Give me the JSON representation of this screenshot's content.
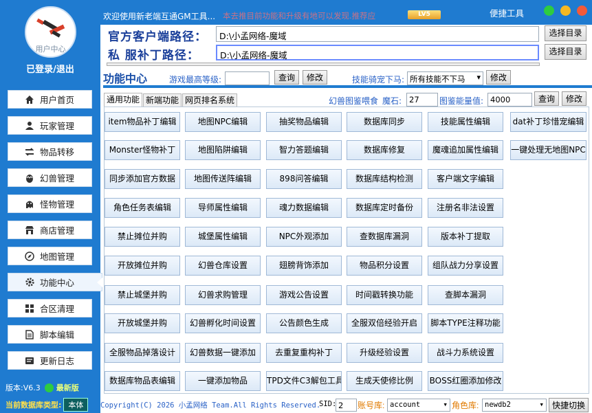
{
  "sidebar": {
    "logo_text": "用户中心",
    "login_text": "已登录/退出",
    "items": [
      {
        "label": "用户首页",
        "icon": "home-icon"
      },
      {
        "label": "玩家管理",
        "icon": "user-icon"
      },
      {
        "label": "物品转移",
        "icon": "transfer-icon"
      },
      {
        "label": "幻兽管理",
        "icon": "egg-icon"
      },
      {
        "label": "怪物管理",
        "icon": "monster-icon"
      },
      {
        "label": "商店管理",
        "icon": "shop-icon"
      },
      {
        "label": "地图管理",
        "icon": "map-icon"
      },
      {
        "label": "功能中心",
        "icon": "gear-icon"
      },
      {
        "label": "合区清理",
        "icon": "merge-icon"
      },
      {
        "label": "脚本编辑",
        "icon": "document-icon"
      },
      {
        "label": "更新日志",
        "icon": "log-icon"
      }
    ],
    "version_label": "版本:V6.3",
    "latest_label": "最新版",
    "db_type_label": "当前数据库类型:",
    "db_type_value": "本体"
  },
  "topbar": {
    "welcome": "欢迎使用新老端互通GM工具...",
    "notice": "本去推目前功能和升级有地可以发现.推荐应",
    "level_badge": "LV5",
    "quick_tools": "便捷工具"
  },
  "paths": {
    "client_label": "官方客户端路径：",
    "client_value": "D:\\小孟网络-魔域",
    "patch_label": "私  服补丁路径：",
    "patch_value": "D:\\小孟网络-魔域",
    "select_label": "选择目录"
  },
  "function_center": {
    "title": "功能中心",
    "max_level_label": "游戏最高等级:",
    "max_level_value": "",
    "query_label": "查询",
    "modify_label": "修改",
    "skill_label": "技能骑宠下马:",
    "skill_value": "所有技能不下马",
    "feed_label": "幻兽图鉴喂食",
    "magic_stone_label": "魔石:",
    "magic_stone_value": "27",
    "energy_label": "图鉴能量值:",
    "energy_value": "4000"
  },
  "tabs": [
    "通用功能",
    "新端功能",
    "网页排名系统"
  ],
  "buttons": [
    [
      "item物品补丁编辑",
      "地图NPC编辑",
      "抽奖物品编辑",
      "数据库同步",
      "技能属性编辑",
      "dat补丁珍惜宠编辑"
    ],
    [
      "Monster怪物补丁",
      "地图陷阱编辑",
      "智力答题编辑",
      "数据库修复",
      "魔魂追加属性编辑",
      "一键处理无地图NPC"
    ],
    [
      "同步添加官方数据",
      "地图传送阵编辑",
      "898问答编辑",
      "数据库结构检测",
      "客户端文字编辑"
    ],
    [
      "角色任务表编辑",
      "导师属性编辑",
      "魂力数据编辑",
      "数据库定时备份",
      "注册名非法设置"
    ],
    [
      "禁止摊位并购",
      "城堡属性编辑",
      "NPC外观添加",
      "查数据库漏洞",
      "版本补丁提取"
    ],
    [
      "开放摊位并购",
      "幻兽仓库设置",
      "翅膀背饰添加",
      "物品积分设置",
      "组队战力分享设置"
    ],
    [
      "禁止城堡并购",
      "幻兽求购管理",
      "游戏公告设置",
      "时间戳转换功能",
      "查脚本漏洞"
    ],
    [
      "开放城堡并购",
      "幻兽孵化时间设置",
      "公告颜色生成",
      "全服双倍经验开启",
      "脚本TYPE注释功能"
    ],
    [
      "全服物品掉落设计",
      "幻兽数据一键添加",
      "去重复重构补丁",
      "升级经验设置",
      "战斗力系统设置"
    ],
    [
      "数据库物品表编辑",
      "一键添加物品",
      "TPD文件C3解包工具",
      "生成天使修比例",
      "BOSS红圈添加修改"
    ]
  ],
  "footer": {
    "copyright": "Copyright(C) 2026 小孟网络 Team.All Rights Reserved.",
    "sid_label": "SID:",
    "sid_value": "2",
    "account_db_label": "账号库:",
    "account_db_value": "account",
    "role_db_label": "角色库:",
    "role_db_value": "newdb2",
    "switch_label": "快捷切换"
  },
  "colors": {
    "sidebar": "#1f7bd0",
    "accent_blue": "#1a3f9a",
    "link_blue": "#2a62c7"
  }
}
